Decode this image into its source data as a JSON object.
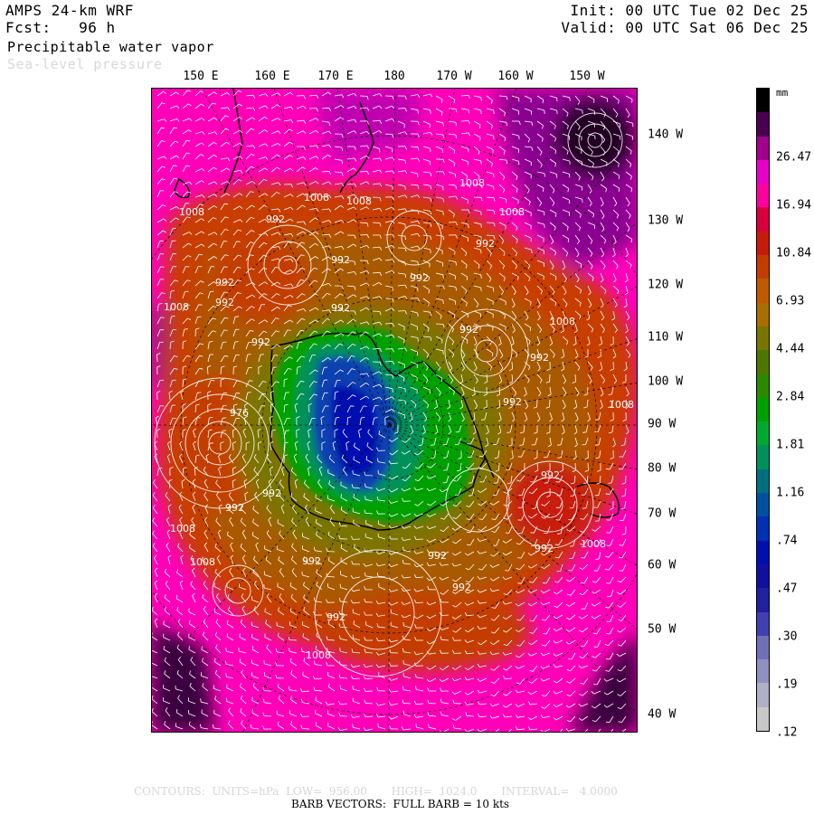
{
  "header": {
    "model": "AMPS 24-km WRF",
    "forecast": "Fcst:   96 h",
    "field": "Precipitable water vapor",
    "overlay": "Sea-level pressure",
    "init": "Init: 00 UTC Tue 02 Dec 25",
    "valid": "Valid: 00 UTC Sat 06 Dec 25"
  },
  "top_labels": [
    "150 E",
    "160 E",
    "170 E",
    "180",
    "170 W",
    "160 W",
    "150 W"
  ],
  "right_labels": [
    "140 W",
    "130 W",
    "120 W",
    "110 W",
    "100 W",
    "90 W",
    "80 W",
    "70 W",
    "60 W",
    "50 W",
    "40 W"
  ],
  "colorbar": {
    "units": "mm",
    "labels": [
      "26.47",
      "16.94",
      "10.84",
      "6.93",
      "4.44",
      "2.84",
      "1.81",
      "1.16",
      ".74",
      ".47",
      ".30",
      ".19",
      ".12"
    ],
    "colors": [
      "#000000",
      "#4a0050",
      "#a0008c",
      "#e800c8",
      "#ff00a0",
      "#d8003c",
      "#c81a0a",
      "#c43c00",
      "#c05a00",
      "#a86e00",
      "#7a7400",
      "#4c7800",
      "#2a8a00",
      "#00a000",
      "#00aa30",
      "#00905a",
      "#007080",
      "#0050a0",
      "#0030b4",
      "#0010b0",
      "#1010a0",
      "#2020a0",
      "#4040b0",
      "#7070b8",
      "#9090c0",
      "#b0b0c8",
      "#c8c8c8"
    ]
  },
  "map": {
    "contour_labels": [
      "1008",
      "1008",
      "1008",
      "1008",
      "992",
      "992",
      "992",
      "1008",
      "992",
      "992",
      "1008",
      "992",
      "992",
      "1008",
      "992",
      "976",
      "992",
      "992",
      "1008",
      "1008",
      "992",
      "992",
      "992",
      "992",
      "992",
      "1008",
      "1008",
      "992",
      "1008",
      "992",
      "992",
      "992"
    ]
  },
  "footer": {
    "contours": "CONTOURS:  UNITS=hPa  LOW=  956.00       HIGH=  1024.0       INTERVAL=   4.0000",
    "barbs": "BARB VECTORS:  FULL BARB = 10 kts"
  }
}
